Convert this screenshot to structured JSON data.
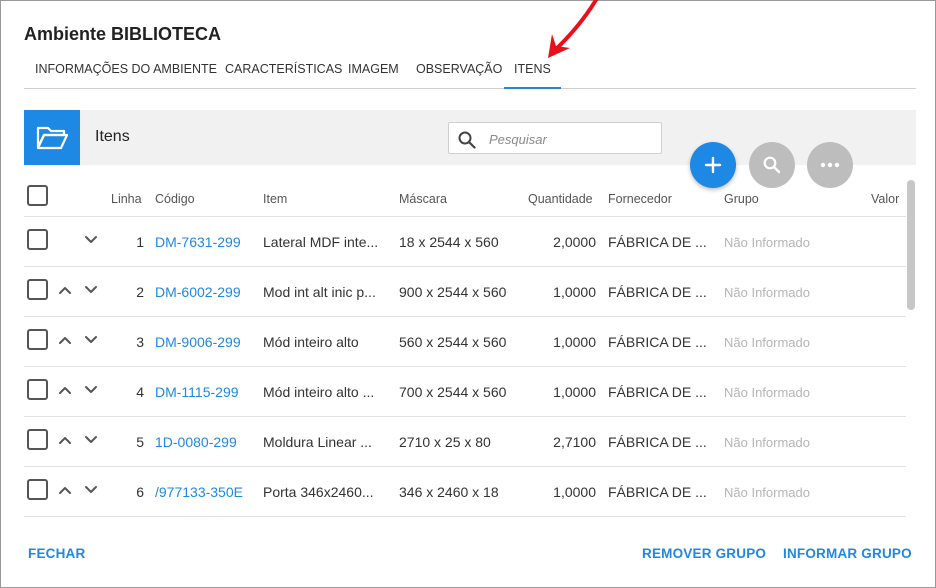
{
  "dialog": {
    "title": "Ambiente BIBLIOTECA"
  },
  "tabs": [
    {
      "label": "INFORMAÇÕES DO AMBIENTE"
    },
    {
      "label": "CARACTERÍSTICAS"
    },
    {
      "label": "IMAGEM"
    },
    {
      "label": "OBSERVAÇÃO"
    },
    {
      "label": "ITENS"
    }
  ],
  "panel": {
    "title": "Itens",
    "search_placeholder": "Pesquisar",
    "icon": "folder-open-icon"
  },
  "actions": {
    "add": "plus-icon",
    "search": "search-icon",
    "more": "more-horizontal-icon"
  },
  "table": {
    "headers": {
      "line": "Linha",
      "code": "Código",
      "item": "Item",
      "mask": "Máscara",
      "qty": "Quantidade",
      "supplier": "Fornecedor",
      "group": "Grupo",
      "value": "Valor"
    },
    "rows": [
      {
        "line": "1",
        "code": "DM-7631-299",
        "item": "Lateral MDF inte...",
        "mask": "18 x 2544 x 560",
        "qty": "2,0000",
        "supplier": "FÁBRICA DE ...",
        "group": "Não Informado"
      },
      {
        "line": "2",
        "code": "DM-6002-299",
        "item": "Mod int alt inic p...",
        "mask": "900 x 2544 x 560",
        "qty": "1,0000",
        "supplier": "FÁBRICA DE ...",
        "group": "Não Informado"
      },
      {
        "line": "3",
        "code": "DM-9006-299",
        "item": "Mód inteiro alto",
        "mask": "560 x 2544 x 560",
        "qty": "1,0000",
        "supplier": "FÁBRICA DE ...",
        "group": "Não Informado"
      },
      {
        "line": "4",
        "code": "DM-1115-299",
        "item": "Mód inteiro alto ...",
        "mask": "700 x 2544 x 560",
        "qty": "1,0000",
        "supplier": "FÁBRICA DE ...",
        "group": "Não Informado"
      },
      {
        "line": "5",
        "code": "1D-0080-299",
        "item": "Moldura Linear ...",
        "mask": "2710 x 25 x 80",
        "qty": "2,7100",
        "supplier": "FÁBRICA DE ...",
        "group": "Não Informado"
      },
      {
        "line": "6",
        "code": "/977133-350E",
        "item": "Porta 346x2460...",
        "mask": "346 x 2460 x 18",
        "qty": "1,0000",
        "supplier": "FÁBRICA DE ...",
        "group": "Não Informado"
      }
    ]
  },
  "footer": {
    "close": "FECHAR",
    "remove_group": "REMOVER GRUPO",
    "set_group": "INFORMAR GRUPO"
  },
  "colors": {
    "accent": "#1e88e5",
    "annotation_arrow": "#e8101a",
    "muted": "#b5b5b5"
  }
}
